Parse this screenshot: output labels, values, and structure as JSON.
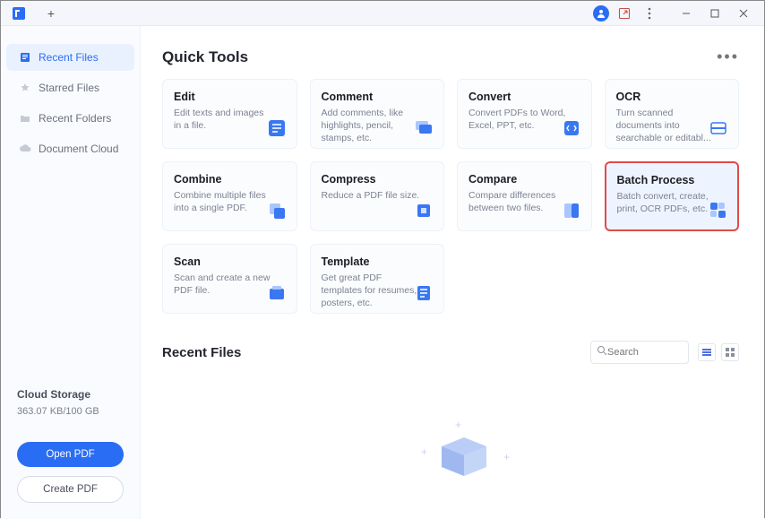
{
  "sidebar": {
    "items": [
      {
        "label": "Recent Files"
      },
      {
        "label": "Starred Files"
      },
      {
        "label": "Recent Folders"
      },
      {
        "label": "Document Cloud"
      }
    ],
    "cloud_storage_label": "Cloud Storage",
    "cloud_storage_size": "363.07 KB/100 GB",
    "open_pdf_label": "Open PDF",
    "create_pdf_label": "Create PDF"
  },
  "quick_tools": {
    "title": "Quick Tools",
    "cards": [
      {
        "title": "Edit",
        "desc": "Edit texts and images in a file."
      },
      {
        "title": "Comment",
        "desc": "Add comments, like highlights, pencil, stamps, etc."
      },
      {
        "title": "Convert",
        "desc": "Convert PDFs to Word, Excel, PPT, etc."
      },
      {
        "title": "OCR",
        "desc": "Turn scanned documents into searchable or editabl..."
      },
      {
        "title": "Combine",
        "desc": "Combine multiple files into a single PDF."
      },
      {
        "title": "Compress",
        "desc": "Reduce a PDF file size."
      },
      {
        "title": "Compare",
        "desc": "Compare differences between two files."
      },
      {
        "title": "Batch Process",
        "desc": "Batch convert, create, print, OCR PDFs, etc."
      },
      {
        "title": "Scan",
        "desc": "Scan and create a new PDF file."
      },
      {
        "title": "Template",
        "desc": "Get great PDF templates for resumes, posters, etc."
      }
    ]
  },
  "recent": {
    "title": "Recent Files",
    "search_placeholder": "Search"
  }
}
